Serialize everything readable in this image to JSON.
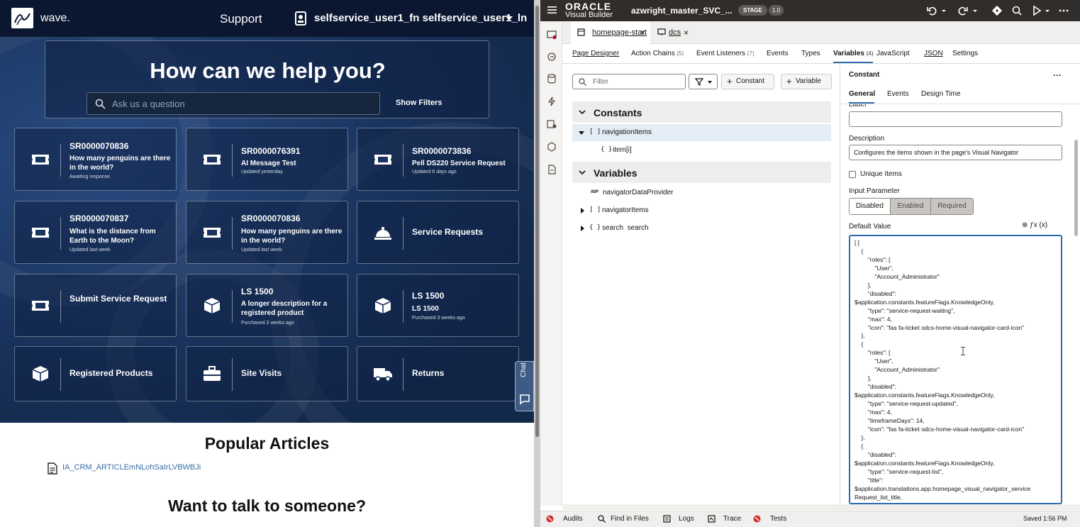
{
  "app": {
    "brand": "wave.",
    "nav_support": "Support",
    "user_name": "selfservice_user1_fn selfservice_user1_ln",
    "hero_title": "How can we help you?",
    "search_placeholder": "Ask us a question",
    "show_filters": "Show Filters",
    "cards": [
      {
        "id": "SR0000070836",
        "title": "How many penguins are there in the world?",
        "status": "Awaiting response",
        "icon": "ticket-icon"
      },
      {
        "id": "SR0000076391",
        "title": "AI Message Test",
        "status": "Updated yesterday",
        "icon": "ticket-icon"
      },
      {
        "id": "SR0000073836",
        "title": "Pell DS220 Service Request",
        "status": "Updated 6 days ago",
        "icon": "ticket-icon"
      },
      {
        "id": "SR0000070837",
        "title": "What is the distance from Earth to the Moon?",
        "status": "Updated last week",
        "icon": "ticket-icon"
      },
      {
        "id": "SR0000070836",
        "title": "How many penguins are there in the world?",
        "status": "Updated last week",
        "icon": "ticket-icon"
      },
      {
        "label": "Service Requests",
        "icon": "bell-icon"
      },
      {
        "label": "Submit Service Request",
        "icon": "ticket-icon"
      },
      {
        "id": "LS 1500",
        "title": "A longer description for a registered product",
        "status": "Purchased 3 weeks ago",
        "icon": "box-icon"
      },
      {
        "id": "LS 1500",
        "title": "LS 1500",
        "status": "Purchased 3 weeks ago",
        "icon": "box-icon"
      },
      {
        "label": "Registered Products",
        "icon": "box-icon"
      },
      {
        "label": "Site Visits",
        "icon": "toolbox-icon"
      },
      {
        "label": "Returns",
        "icon": "truck-icon"
      }
    ],
    "chat_label": "Chat",
    "popular_title": "Popular Articles",
    "article_link": "IA_CRM_ARTICLEmNLohSaIrLVBWBJi",
    "talk_title": "Want to talk to someone?"
  },
  "vb": {
    "oracle": "ORACLE",
    "product": "Visual Builder",
    "project": "azwright_master_SVC_...",
    "stage": "STAGE",
    "version": "1.0",
    "file_tabs": [
      {
        "label": "homepage-start"
      },
      {
        "label": "dcs"
      }
    ],
    "sub_tabs": [
      {
        "label": "Page Designer",
        "count": ""
      },
      {
        "label": "Action Chains",
        "count": "(5)"
      },
      {
        "label": "Event Listeners",
        "count": "(7)"
      },
      {
        "label": "Events",
        "count": ""
      },
      {
        "label": "Types",
        "count": ""
      },
      {
        "label": "Variables",
        "count": "(4)"
      },
      {
        "label": "JavaScript",
        "count": ""
      },
      {
        "label": "JSON",
        "count": ""
      },
      {
        "label": "Settings",
        "count": ""
      }
    ],
    "filter_placeholder": "Filter",
    "add_constant": "Constant",
    "add_variable": "Variable",
    "constants_heading": "Constants",
    "variables_heading": "Variables",
    "tree": {
      "navigationItems": {
        "type": "[ ]",
        "name": "navigationItems"
      },
      "item": {
        "type": "{ }",
        "name": "item[i]"
      },
      "navigatorDataProvider": {
        "type": "ADP",
        "name": "navigatorDataProvider"
      },
      "navigatorItems": {
        "type": "[ ]",
        "name": "navigatorItems"
      },
      "search": {
        "type": "{ }",
        "name": "search  search"
      }
    },
    "props": {
      "title": "Constant",
      "more": "···",
      "tabs": [
        "General",
        "Events",
        "Design Time"
      ],
      "label_cut": "Label",
      "description_label": "Description",
      "description_value": "Configures the items shown in the page's Visual Navigator",
      "unique_label": "Unique Items",
      "input_param_label": "Input Parameter",
      "input_param_options": [
        "Disabled",
        "Enabled",
        "Required"
      ],
      "default_value_label": "Default Value",
      "default_value_icons": "⊕  ƒx  (x)",
      "code": "[ [\n    {\n        \"roles\": [\n            \"User\",\n            \"Account_Administrator\"\n        ],\n        \"disabled\":\n$application.constants.featureFlags.KnowledgeOnly,\n        \"type\": \"service-request-waiting\",\n        \"max\": 4,\n        \"icon\": \"fas fa-ticket odcs-home-visual-navigator-card-icon\"\n    },\n    {\n        \"roles\": [\n            \"User\",\n            \"Account_Administrator\"\n        ],\n        \"disabled\":\n$application.constants.featureFlags.KnowledgeOnly,\n        \"type\": \"service-request-updated\",\n        \"max\": 4,\n        \"timeframeDays\": 14,\n        \"icon\": \"fas fa-ticket odcs-home-visual-navigator-card-icon\"\n    },\n    {\n        \"disabled\":\n$application.constants.featureFlags.KnowledgeOnly,\n        \"type\": \"service-request-list\",\n        \"title\":\n$application.translations.app.homepage_visual_navigator_service\nRequest_list_title,"
    },
    "status": {
      "audits": "Audits",
      "find": "Find in Files",
      "logs": "Logs",
      "trace": "Trace",
      "tests": "Tests",
      "saved": "Saved 1:56 PM"
    },
    "colors": {
      "accent": "#2b6cb0",
      "header": "#312d2a",
      "error": "#d32f2f"
    }
  }
}
